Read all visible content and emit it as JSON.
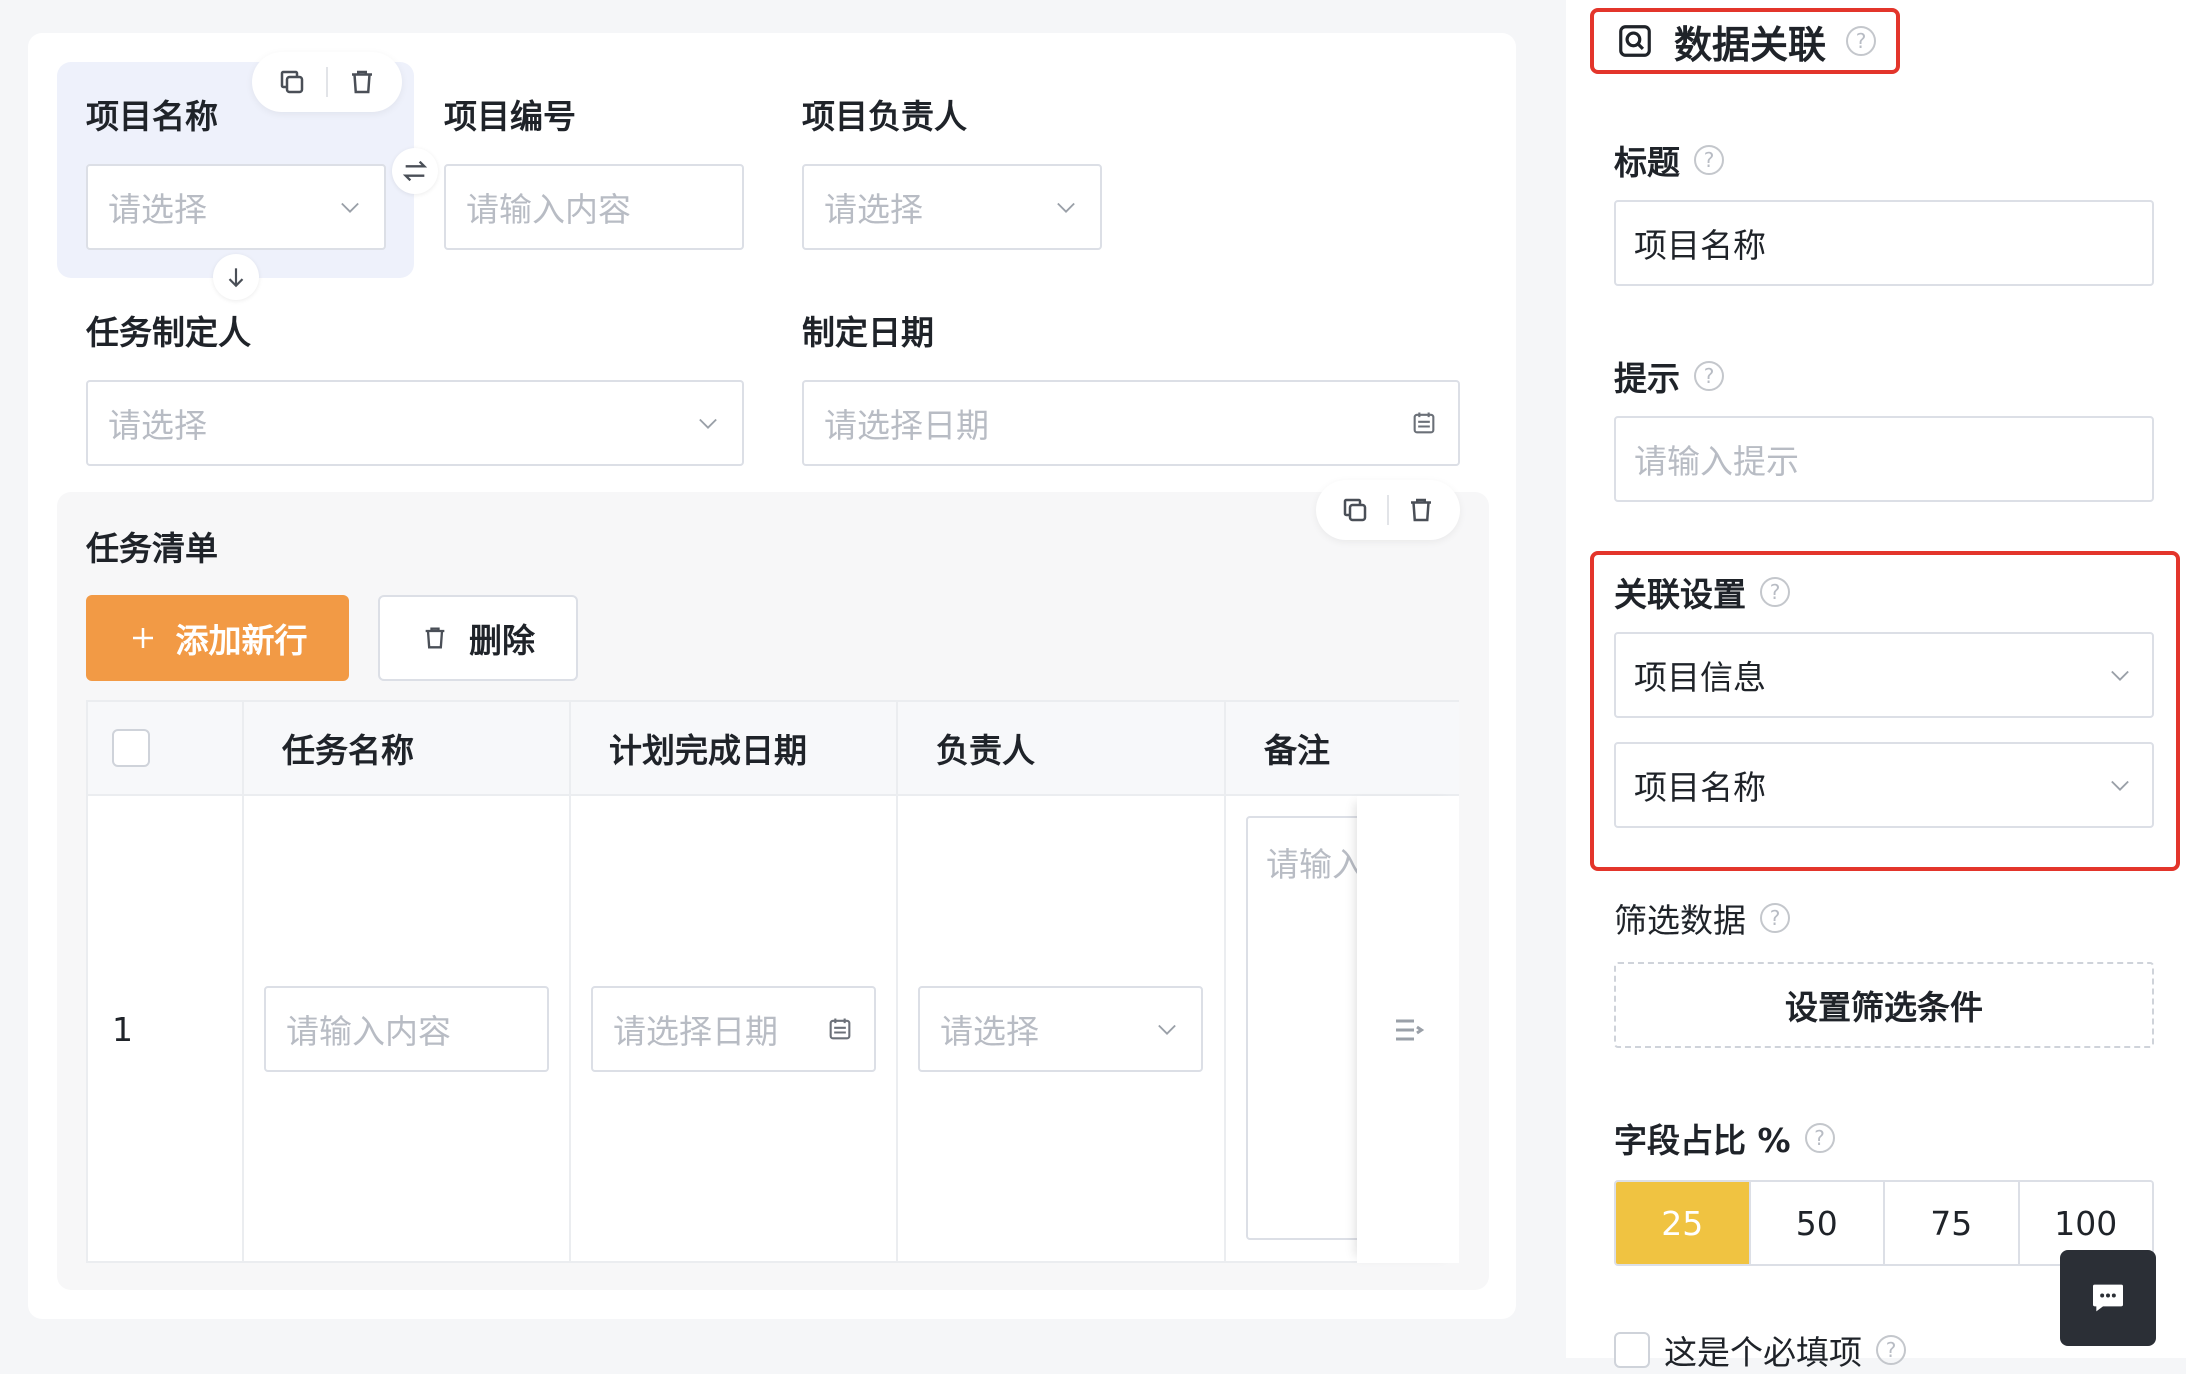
{
  "form": {
    "fields": {
      "project_name": {
        "label": "项目名称",
        "placeholder": "请选择"
      },
      "project_code": {
        "label": "项目编号",
        "placeholder": "请输入内容"
      },
      "project_owner": {
        "label": "项目负责人",
        "placeholder": "请选择"
      },
      "task_creator": {
        "label": "任务制定人",
        "placeholder": "请选择"
      },
      "created_date": {
        "label": "制定日期",
        "placeholder": "请选择日期"
      }
    },
    "subform": {
      "title": "任务清单",
      "add_row_label": "添加新行",
      "delete_label": "删除",
      "columns": [
        "任务名称",
        "计划完成日期",
        "负责人",
        "备注"
      ],
      "rows": [
        {
          "index": "1",
          "task_name_placeholder": "请输入内容",
          "due_date_placeholder": "请选择日期",
          "owner_placeholder": "请选择",
          "remark_placeholder": "请输入"
        }
      ]
    }
  },
  "panel": {
    "title": "数据关联",
    "title_label": "标题",
    "title_value": "项目名称",
    "hint_label": "提示",
    "hint_placeholder": "请输入提示",
    "relate_label": "关联设置",
    "relate_source": "项目信息",
    "relate_field": "项目名称",
    "filter_label": "筛选数据",
    "filter_button": "设置筛选条件",
    "ratio_label": "字段占比 %",
    "ratio_options": [
      "25",
      "50",
      "75",
      "100"
    ],
    "ratio_selected": "25",
    "required_label": "这是个必填项"
  },
  "colors": {
    "accent_orange": "#f29a45",
    "highlight_red": "#e3352b",
    "ratio_active": "#f0c341"
  }
}
